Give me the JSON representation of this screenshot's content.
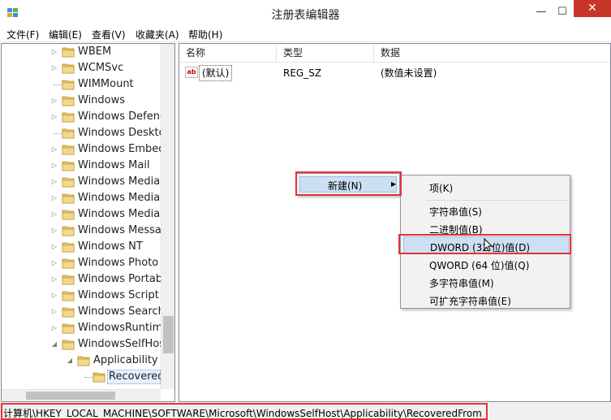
{
  "window": {
    "title": "注册表编辑器",
    "min_glyph": "—",
    "max_glyph": "☐",
    "close_glyph": "✕"
  },
  "menubar": [
    {
      "label": "文件(F)"
    },
    {
      "label": "编辑(E)"
    },
    {
      "label": "查看(V)"
    },
    {
      "label": "收藏夹(A)"
    },
    {
      "label": "帮助(H)"
    }
  ],
  "tree": {
    "items": [
      {
        "label": "WBEM",
        "expander": "collapsed"
      },
      {
        "label": "WCMSvc",
        "expander": "collapsed"
      },
      {
        "label": "WIMMount",
        "expander": "none"
      },
      {
        "label": "Windows",
        "expander": "collapsed"
      },
      {
        "label": "Windows Defende",
        "expander": "collapsed"
      },
      {
        "label": "Windows Desktop",
        "expander": "none"
      },
      {
        "label": "Windows Embedc",
        "expander": "collapsed"
      },
      {
        "label": "Windows Mail",
        "expander": "collapsed"
      },
      {
        "label": "Windows Media D",
        "expander": "collapsed"
      },
      {
        "label": "Windows Media F",
        "expander": "collapsed"
      },
      {
        "label": "Windows Media P",
        "expander": "collapsed"
      },
      {
        "label": "Windows Messag",
        "expander": "collapsed"
      },
      {
        "label": "Windows NT",
        "expander": "collapsed"
      },
      {
        "label": "Windows Photo V",
        "expander": "collapsed"
      },
      {
        "label": "Windows Portable",
        "expander": "collapsed"
      },
      {
        "label": "Windows Script H",
        "expander": "collapsed"
      },
      {
        "label": "Windows Search",
        "expander": "collapsed"
      },
      {
        "label": "WindowsRuntime",
        "expander": "collapsed"
      },
      {
        "label": "WindowsSelfHost",
        "expander": "expanded"
      },
      {
        "label": "Applicability",
        "expander": "expanded"
      },
      {
        "label": "RecoveredF",
        "expander": "none"
      }
    ]
  },
  "list": {
    "columns": [
      {
        "label": "名称"
      },
      {
        "label": "类型"
      },
      {
        "label": "数据"
      }
    ],
    "rows": [
      {
        "name": "(默认)",
        "type": "REG_SZ",
        "data": "(数值未设置)",
        "icon": "ab-string-icon"
      }
    ]
  },
  "context_menu": {
    "new_label": "新建(N)",
    "arrow_glyph": "▶",
    "submenu": [
      {
        "label": "项(K)"
      },
      {
        "label": "字符串值(S)"
      },
      {
        "label": "二进制值(B)"
      },
      {
        "label": "DWORD (32 位)值(D)"
      },
      {
        "label": "QWORD (64 位)值(Q)"
      },
      {
        "label": "多字符串值(M)"
      },
      {
        "label": "可扩充字符串值(E)"
      }
    ]
  },
  "statusbar": {
    "path": "计算机\\HKEY_LOCAL_MACHINE\\SOFTWARE\\Microsoft\\WindowsSelfHost\\Applicability\\RecoveredFrom"
  },
  "colors": {
    "highlight": "#cde0f3",
    "annotation_red": "#e8303b",
    "folder": "#e8c46a",
    "close_red": "#c7352a"
  }
}
